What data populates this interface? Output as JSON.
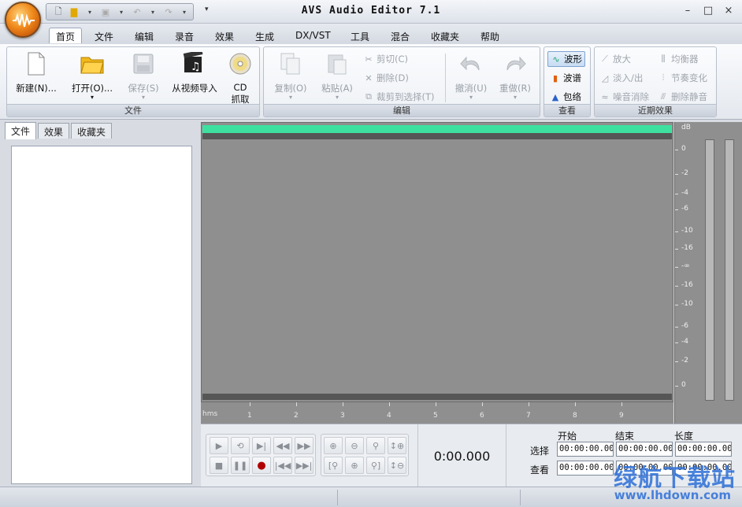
{
  "window": {
    "title": "AVS Audio Editor 7.1",
    "controls": [
      "–",
      "□",
      "×"
    ]
  },
  "menu": {
    "tabs": [
      "首页",
      "文件",
      "编辑",
      "录音",
      "效果",
      "生成",
      "DX/VST",
      "工具",
      "混合",
      "收藏夹",
      "帮助"
    ],
    "active": "首页"
  },
  "ribbon": {
    "file_group": {
      "label": "文件",
      "new": "新建(N)...",
      "open": "打开(O)...",
      "save": "保存(S)",
      "import_video": "从视频导入",
      "cd_line1": "CD",
      "cd_line2": "抓取"
    },
    "edit_group": {
      "label": "编辑",
      "copy": "复制(O)",
      "paste": "粘贴(A)",
      "cut": "剪切(C)",
      "delete": "删除(D)",
      "crop": "裁剪到选择(T)",
      "undo": "撤消(U)",
      "redo": "重做(R)"
    },
    "view_group": {
      "label": "查看",
      "waveform": "波形",
      "spectrum": "波谱",
      "envelope": "包络"
    },
    "recent_group": {
      "label": "近期效果",
      "amplify": "放大",
      "fade": "淡入/出",
      "noise": "噪音消除",
      "equalizer": "均衡器",
      "tempo": "节奏变化",
      "silence": "删除静音"
    }
  },
  "left_panel": {
    "tabs": [
      "文件",
      "效果",
      "收藏夹"
    ]
  },
  "timeline": {
    "unit": "hms",
    "ticks": [
      "1",
      "2",
      "3",
      "4",
      "5",
      "6",
      "7",
      "8",
      "9"
    ]
  },
  "db_scale": {
    "unit": "dB",
    "labels": [
      "0",
      "-2",
      "-4",
      "-6",
      "-10",
      "-16",
      "-∞",
      "-16",
      "-10",
      "-6",
      "-4",
      "-2",
      "0"
    ]
  },
  "time_display": "0:00.000",
  "selection": {
    "headers": [
      "开始",
      "结束",
      "长度"
    ],
    "rows": [
      {
        "label": "选择",
        "values": [
          "00:00:00.000",
          "00:00:00.000",
          "00:00:00.000"
        ]
      },
      {
        "label": "查看",
        "values": [
          "00:00:00.000",
          "00:00:00.000",
          "00:00:00.000"
        ]
      }
    ]
  },
  "watermark": {
    "text": "绿航下载站",
    "url": "www.lhdown.com"
  }
}
